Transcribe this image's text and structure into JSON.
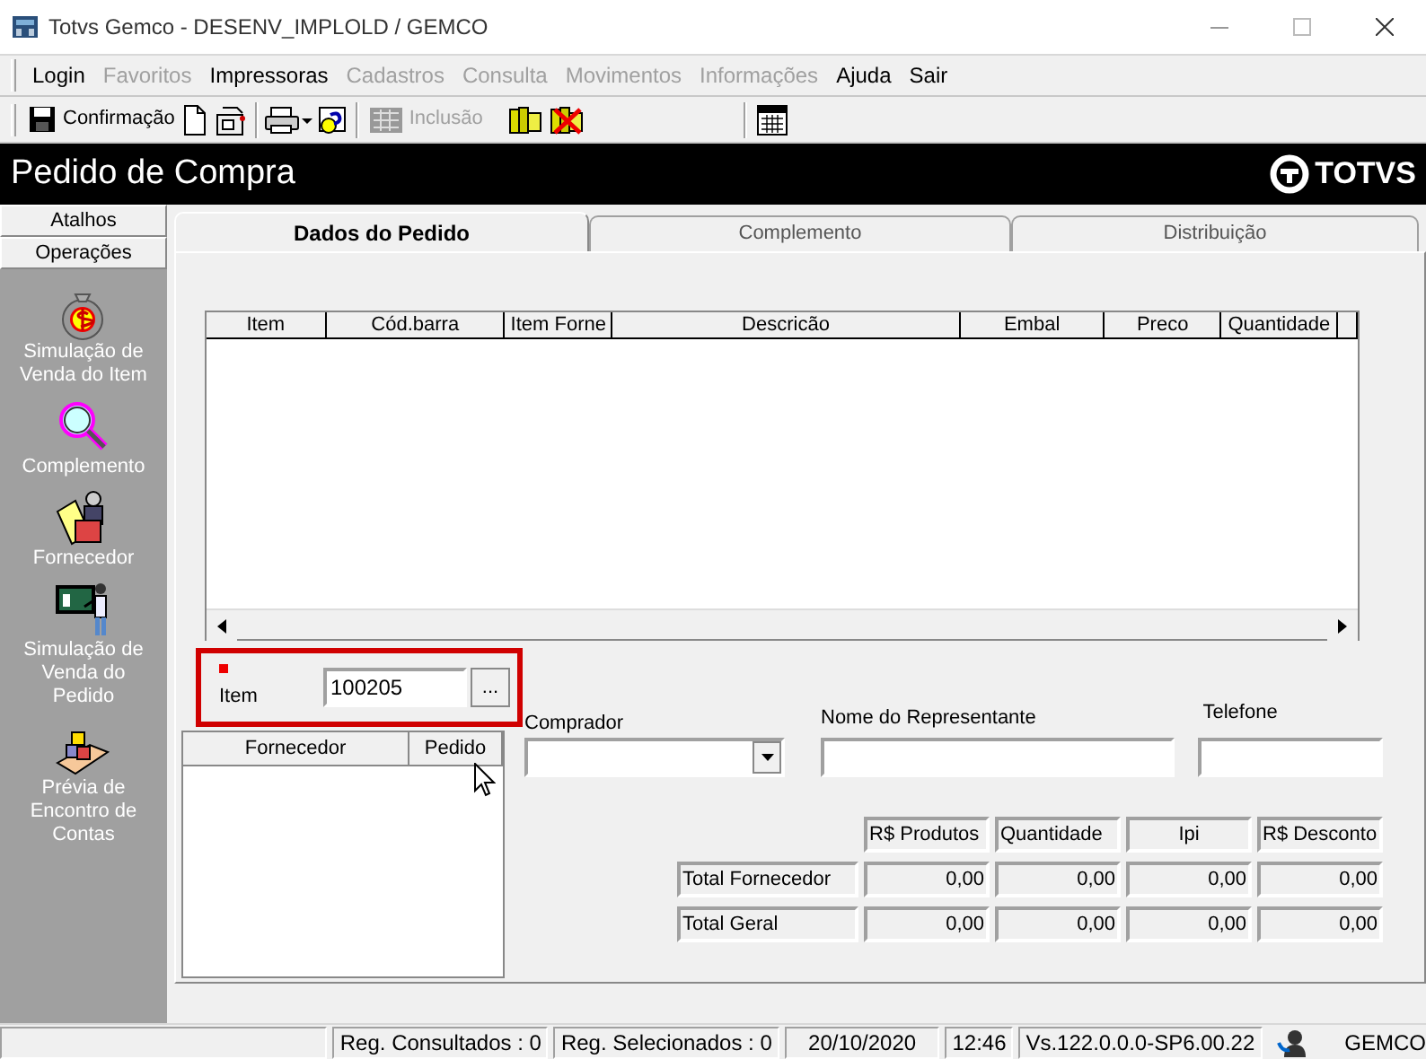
{
  "window": {
    "title": "Totvs Gemco - DESENV_IMPLOLD / GEMCO"
  },
  "menu": [
    {
      "label": "Login",
      "disabled": false
    },
    {
      "label": "Favoritos",
      "disabled": true
    },
    {
      "label": "Impressoras",
      "disabled": false
    },
    {
      "label": "Cadastros",
      "disabled": true
    },
    {
      "label": "Consulta",
      "disabled": true
    },
    {
      "label": "Movimentos",
      "disabled": true
    },
    {
      "label": "Informações",
      "disabled": true
    },
    {
      "label": "Ajuda",
      "disabled": false
    },
    {
      "label": "Sair",
      "disabled": false
    }
  ],
  "toolbar": {
    "confirm": {
      "label": "Confirmação",
      "disabled": false
    },
    "insert": {
      "label": "Inclusão",
      "disabled": true
    }
  },
  "header": {
    "title": "Pedido de Compra",
    "logo": "TOTVS"
  },
  "sidebar": {
    "sections": [
      {
        "label": "Atalhos"
      },
      {
        "label": "Operações"
      }
    ],
    "items": [
      {
        "label": "Simulação de\nVenda do Item"
      },
      {
        "label": "Complemento"
      },
      {
        "label": "Fornecedor"
      },
      {
        "label": "Simulação de\nVenda do\nPedido"
      },
      {
        "label": "Prévia de\nEncontro de\nContas"
      }
    ]
  },
  "tabs": [
    {
      "label": "Dados do Pedido",
      "selected": true
    },
    {
      "label": "Complemento",
      "selected": false
    },
    {
      "label": "Distribuição",
      "selected": false
    }
  ],
  "items_grid": {
    "columns": [
      "Item",
      "Cód.barra",
      "Item Forne",
      "Descricão",
      "Embal",
      "Preco",
      "Quantidade"
    ]
  },
  "item_field": {
    "label": "Item",
    "value": "100205",
    "button": "...",
    "highlighted": true
  },
  "supplier_grid": {
    "columns": [
      "Fornecedor",
      "Pedido"
    ]
  },
  "buyer": {
    "label": "Comprador"
  },
  "representative": {
    "label": "Nome do Representante"
  },
  "phone": {
    "label": "Telefone"
  },
  "totals": {
    "columns": [
      "R$ Produtos",
      "Quantidade",
      "Ipi",
      "R$ Desconto"
    ],
    "rows": [
      {
        "label": "Total Fornecedor",
        "values": [
          "0,00",
          "0,00",
          "0,00",
          "0,00"
        ]
      },
      {
        "label": "Total Geral",
        "values": [
          "0,00",
          "0,00",
          "0,00",
          "0,00"
        ]
      }
    ]
  },
  "status_bar": [
    "Reg. Consultados : 0",
    "Reg. Selecionados : 0",
    "20/10/2020",
    "12:46",
    "Vs.122.0.0.0-SP6.00.22",
    "GEMCO"
  ]
}
